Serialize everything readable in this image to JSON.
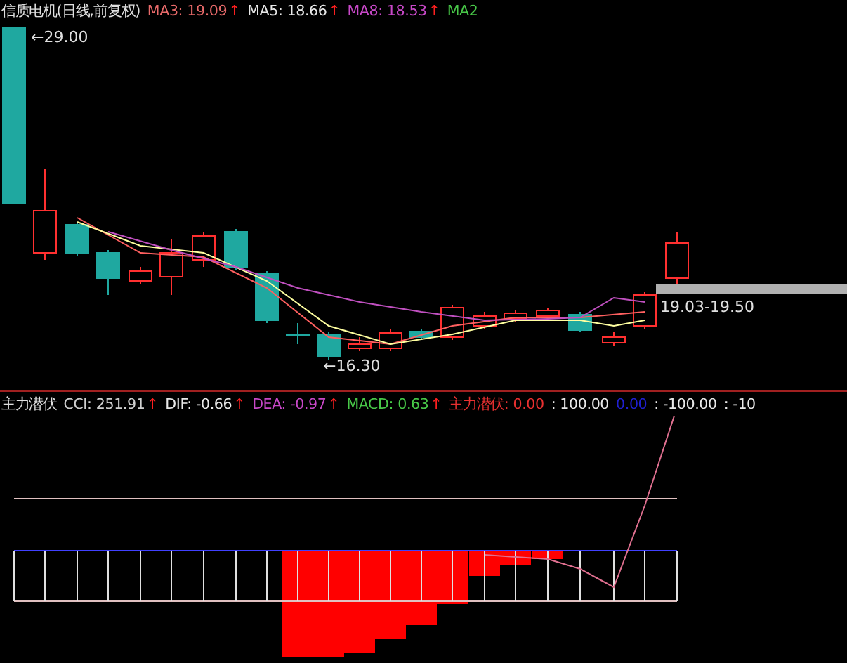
{
  "header": {
    "title": "信质电机(日线,前复权)",
    "indicators": [
      {
        "label": "MA3: 19.09",
        "arrow": "↑",
        "color": "#e86a6a"
      },
      {
        "label": "MA5: 18.66",
        "arrow": "↑",
        "color": "#e8e8e8"
      },
      {
        "label": "MA8: 18.53",
        "arrow": "↑",
        "color": "#c848c8"
      },
      {
        "label": "MA2",
        "color": "#48c848"
      }
    ]
  },
  "price_chart": {
    "labels": [
      "←29.00",
      "←16.30",
      "19.03-19.50"
    ]
  },
  "indicator_header": {
    "title": "主力潜伏",
    "indicators": [
      {
        "label": "CCI: 251.91",
        "arrow": "↑",
        "color": "#d0d0d0"
      },
      {
        "label": "DIF: -0.66",
        "arrow": "↑",
        "color": "#e8e8e8"
      },
      {
        "label": "DEA: -0.97",
        "arrow": "↑",
        "color": "#c848c8"
      },
      {
        "label": "MACD: 0.63",
        "arrow": "↑",
        "color": "#48c848"
      },
      {
        "label": "主力潜伏: 0.00",
        "color": "#e83030"
      },
      {
        "label": ": 100.00",
        "color": "#e8e8e8"
      },
      {
        "label": "0.00",
        "color": "#2020d0"
      },
      {
        "label": ": -100.00",
        "color": "#e8e8e8"
      },
      {
        "label": ": -10",
        "color": "#e8e8e8"
      }
    ]
  }
}
